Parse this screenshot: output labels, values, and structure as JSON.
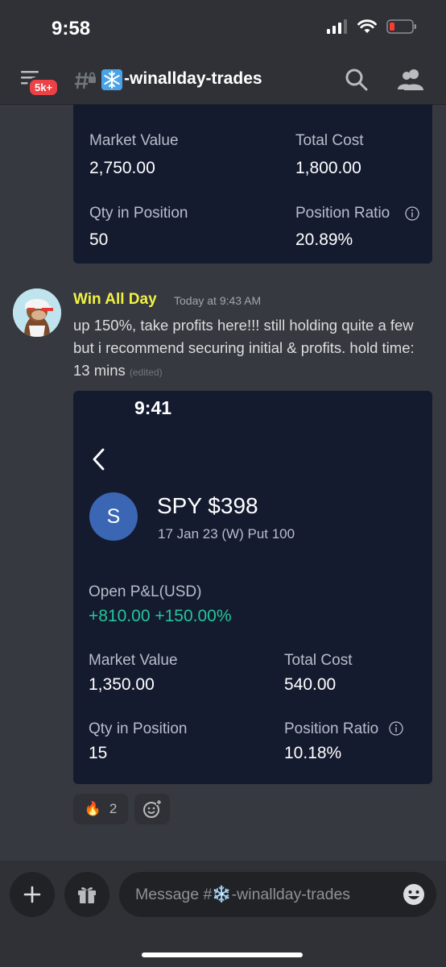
{
  "status_bar": {
    "time": "9:58"
  },
  "header": {
    "badge": "5k+",
    "channel_name": "-winallday-trades"
  },
  "card1": {
    "market_value_label": "Market Value",
    "market_value": "2,750.00",
    "total_cost_label": "Total Cost",
    "total_cost": "1,800.00",
    "qty_label": "Qty in Position",
    "qty": "50",
    "ratio_label": "Position Ratio",
    "ratio": "20.89%"
  },
  "message": {
    "author": "Win All Day",
    "timestamp": "Today at 9:43 AM",
    "text": "up 150%, take profits here!!! still holding quite a few but i recommend securing initial & profits. hold time: 13 mins",
    "edited": "(edited)"
  },
  "card2": {
    "time": "9:41",
    "avatar_letter": "S",
    "symbol": "SPY $398",
    "contract": "17 Jan 23 (W) Put 100",
    "pnl_label": "Open P&L(USD)",
    "pnl_value": "+810.00 +150.00%",
    "market_value_label": "Market Value",
    "market_value": "1,350.00",
    "total_cost_label": "Total Cost",
    "total_cost": "540.00",
    "qty_label": "Qty in Position",
    "qty": "15",
    "ratio_label": "Position Ratio",
    "ratio": "10.18%",
    "accent": "#22c79a"
  },
  "reactions": [
    {
      "emoji": "🔥",
      "count": "2"
    }
  ],
  "composer": {
    "placeholder": "Message #❄️-winallday-trades"
  },
  "colors": {
    "background": "#36393f",
    "card": "#151b2f",
    "author": "#f1f144",
    "badge": "#ed4245"
  }
}
